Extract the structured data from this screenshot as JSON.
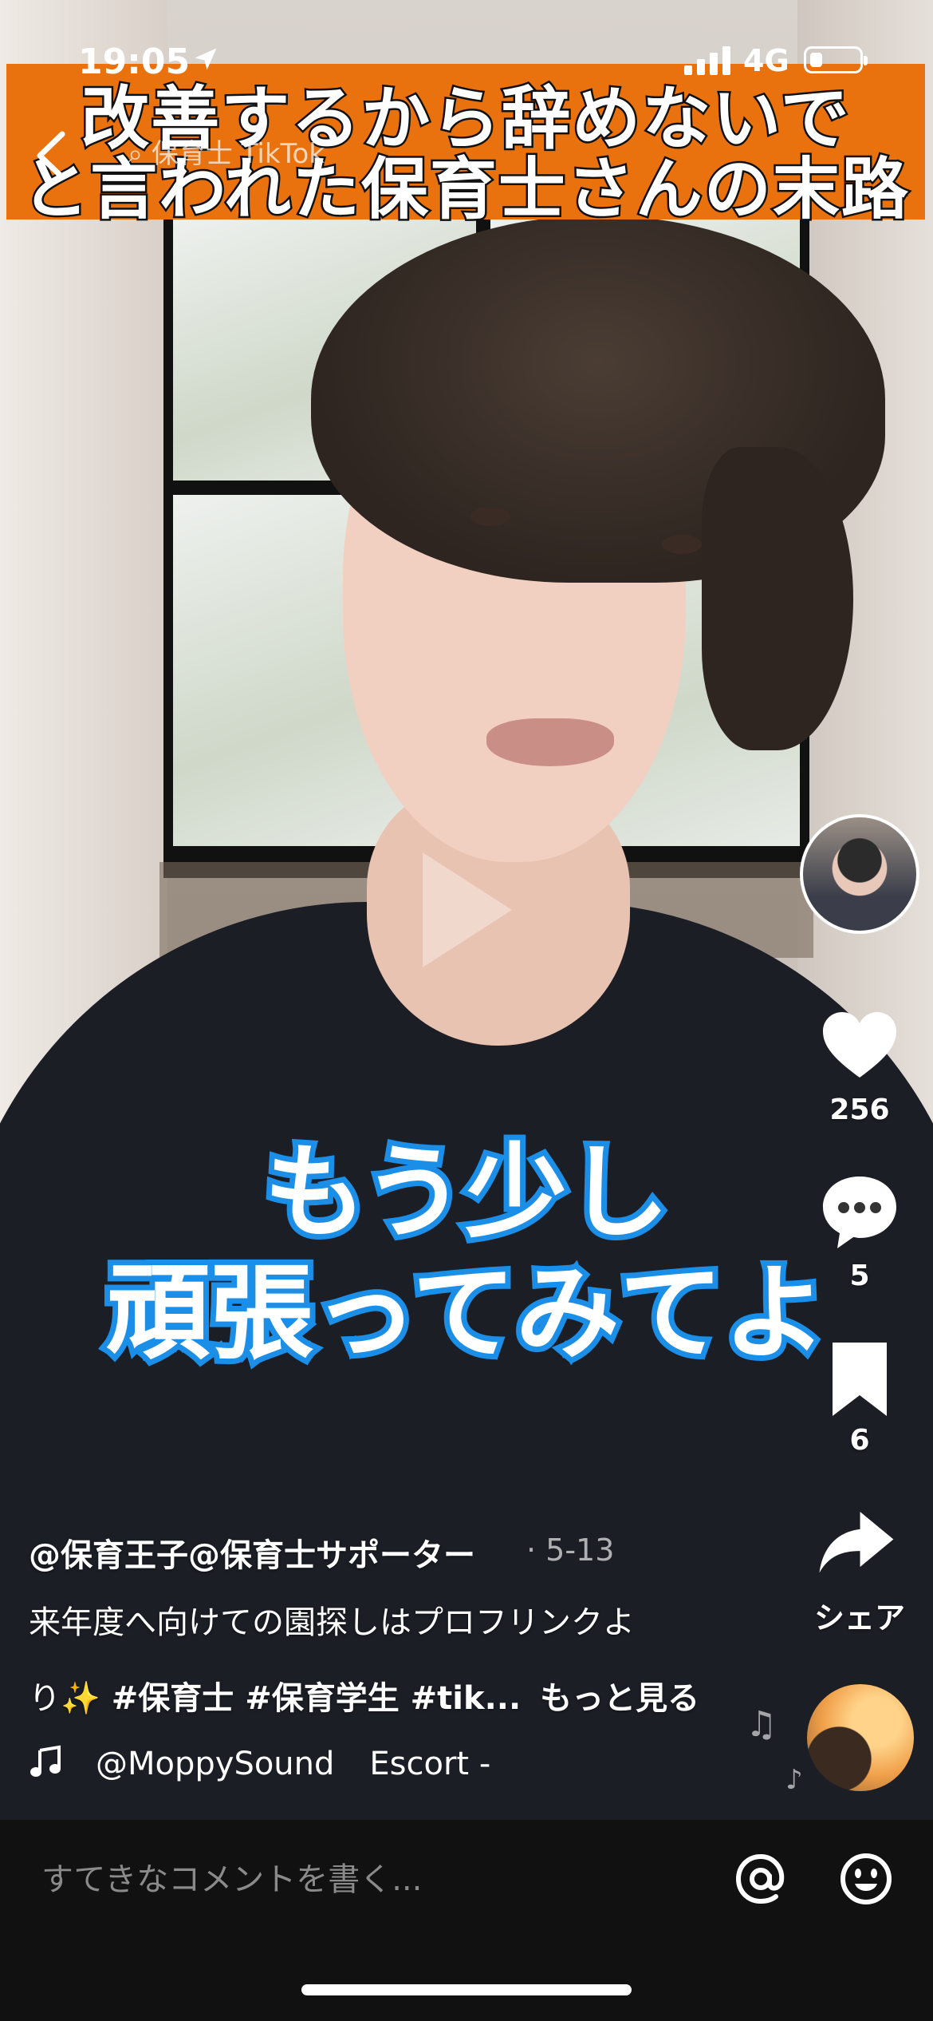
{
  "status_bar": {
    "time": "19:05",
    "network": "4G",
    "battery_level": 0.25
  },
  "video": {
    "title_banner": {
      "line1": "改善するから辞めないで",
      "line2": "と言われた保育士さんの末路"
    },
    "search_hint": "保育士 TikTok",
    "caption": {
      "line1": "もう少し",
      "line2": "頑張ってみてよ"
    }
  },
  "actions": {
    "likes": "256",
    "comments": "5",
    "bookmarks": "6",
    "share_label": "シェア"
  },
  "post": {
    "author": "@保育王子@保育士サポーター",
    "date": "· 5-13",
    "description_line1": "来年度へ向けての園探しはプロフリンクよ",
    "description_line2_prefix": "り",
    "sparkle": "✨",
    "hashtags": "#保育士 #保育学生 #tik...",
    "more_label": "もっと見る",
    "sound_author": "@MoppySound",
    "sound_track": "Escort -"
  },
  "comment_bar": {
    "placeholder": "すてきなコメントを書く..."
  },
  "colors": {
    "banner": "#e9720e",
    "caption_outline": "#1b8fe8",
    "comment_bar": "#111111"
  },
  "icons": [
    "location-arrow-icon",
    "signal-icon",
    "battery-icon",
    "back-chevron-icon",
    "play-icon",
    "heart-icon",
    "comment-icon",
    "bookmark-icon",
    "share-icon",
    "music-note-icon",
    "music-disc-icon",
    "at-mention-icon",
    "emoji-icon"
  ]
}
